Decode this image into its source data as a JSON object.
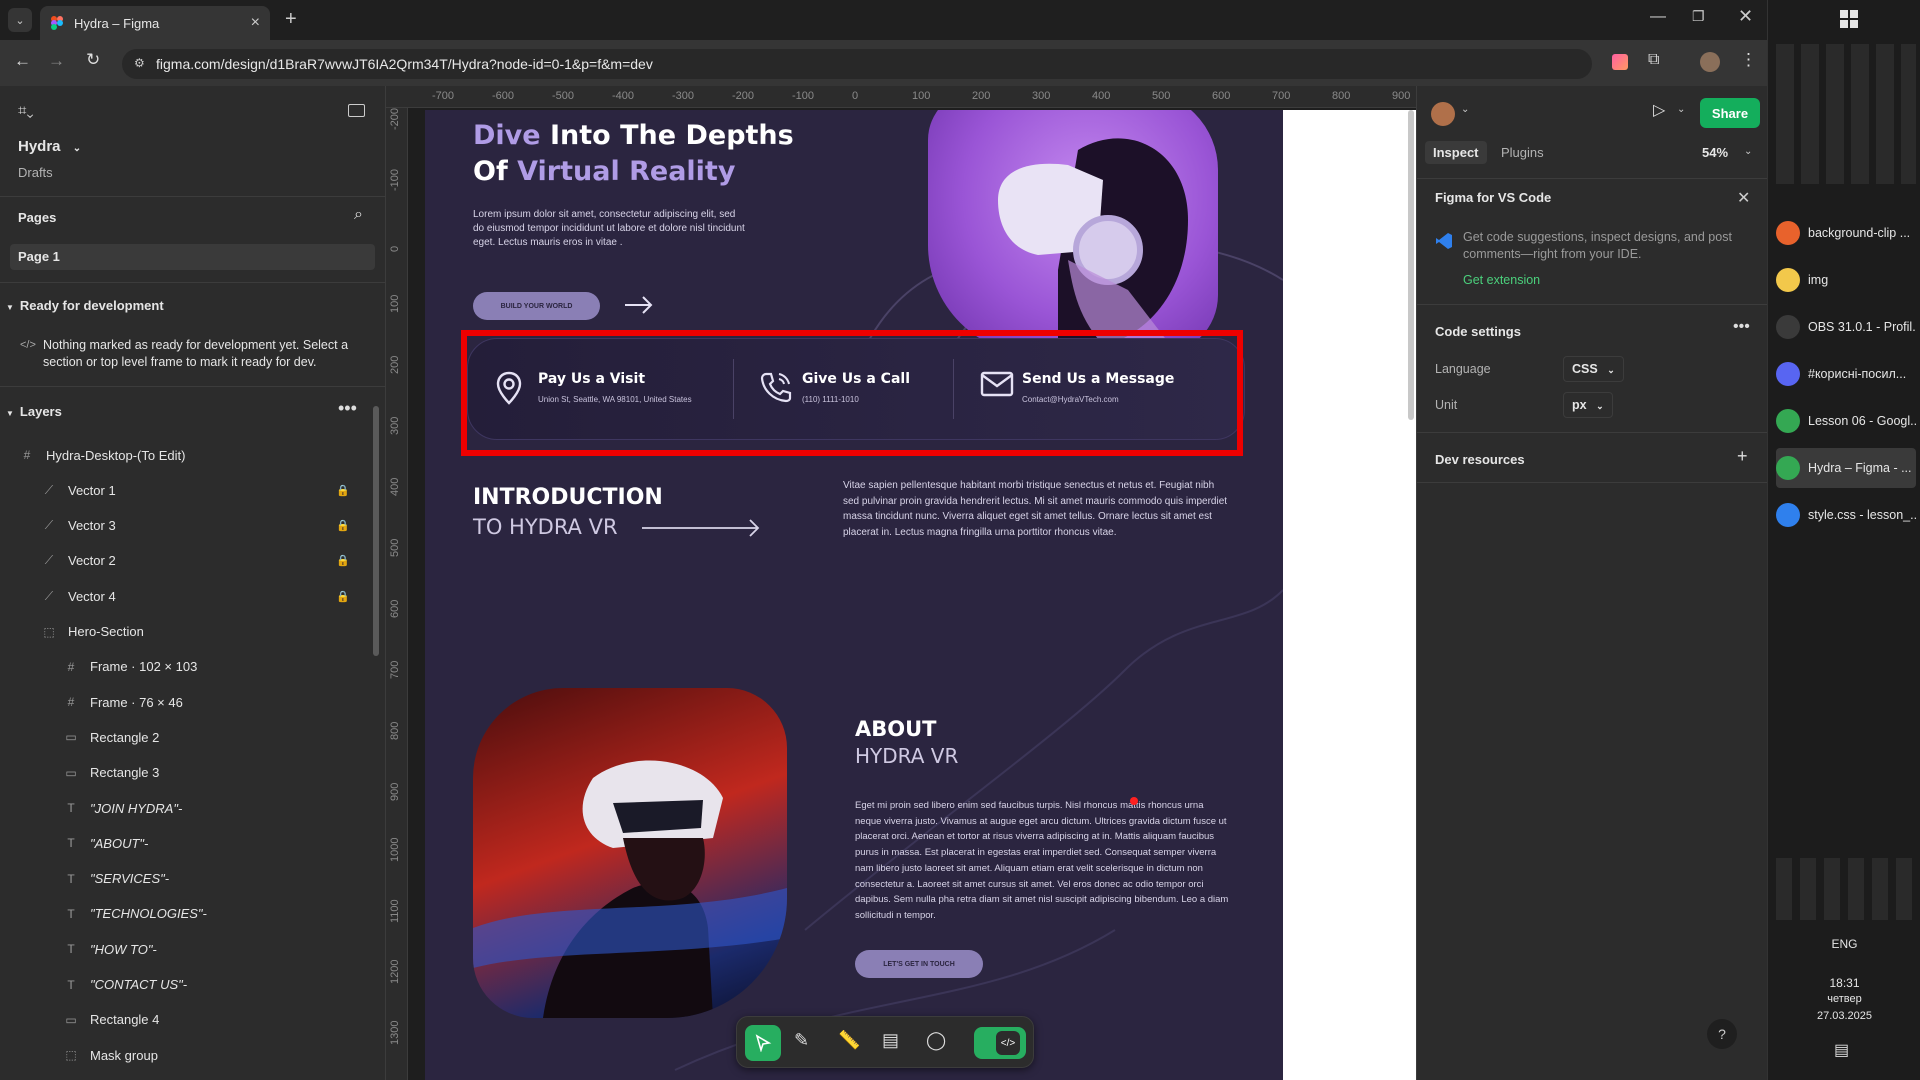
{
  "browser": {
    "tab_title": "Hydra – Figma",
    "url": "figma.com/design/d1BraR7wvwJT6IA2Qrm34T/Hydra?node-id=0-1&p=f&m=dev",
    "new_tab": "+"
  },
  "left_panel": {
    "file_name": "Hydra",
    "file_location": "Drafts",
    "pages_title": "Pages",
    "current_page": "Page 1",
    "ready_title": "Ready for development",
    "ready_message": "Nothing marked as ready for development yet. Select a section or top level frame to mark it ready for dev.",
    "layers_title": "Layers",
    "layers": [
      {
        "name": "Hydra-Desktop-(To Edit)",
        "icon": "frame-icon",
        "indent": 0,
        "locked": false
      },
      {
        "name": "Vector 1",
        "icon": "vector-icon",
        "indent": 1,
        "locked": true
      },
      {
        "name": "Vector 3",
        "icon": "vector-icon",
        "indent": 1,
        "locked": true
      },
      {
        "name": "Vector 2",
        "icon": "vector-icon",
        "indent": 1,
        "locked": true
      },
      {
        "name": "Vector 4",
        "icon": "vector-icon",
        "indent": 1,
        "locked": true
      },
      {
        "name": "Hero-Section",
        "icon": "section-icon",
        "indent": 1,
        "locked": false
      },
      {
        "name": "Frame · 102 × 103",
        "icon": "frame-icon",
        "indent": 2,
        "locked": false
      },
      {
        "name": "Frame · 76 × 46",
        "icon": "frame-icon",
        "indent": 2,
        "locked": false
      },
      {
        "name": "Rectangle 2",
        "icon": "rectangle-icon",
        "indent": 2,
        "locked": false
      },
      {
        "name": "Rectangle 3",
        "icon": "rectangle-icon",
        "indent": 2,
        "locked": false
      },
      {
        "name": "\"JOIN HYDRA\"-",
        "icon": "text-icon",
        "indent": 2,
        "locked": false
      },
      {
        "name": "\"ABOUT\"-",
        "icon": "text-icon",
        "indent": 2,
        "locked": false
      },
      {
        "name": "\"SERVICES\"-",
        "icon": "text-icon",
        "indent": 2,
        "locked": false
      },
      {
        "name": "\"TECHNOLOGIES\"-",
        "icon": "text-icon",
        "indent": 2,
        "locked": false
      },
      {
        "name": "\"HOW TO\"-",
        "icon": "text-icon",
        "indent": 2,
        "locked": false
      },
      {
        "name": "\"CONTACT US\"-",
        "icon": "text-icon",
        "indent": 2,
        "locked": false
      },
      {
        "name": "Rectangle 4",
        "icon": "rectangle-icon",
        "indent": 2,
        "locked": false
      },
      {
        "name": "Mask group",
        "icon": "mask-icon",
        "indent": 2,
        "locked": false
      }
    ]
  },
  "rulers": {
    "top": [
      "-700",
      "-600",
      "-500",
      "-400",
      "-300",
      "-200",
      "-100",
      "0",
      "100",
      "200",
      "300",
      "400",
      "500",
      "600",
      "700",
      "800",
      "900"
    ],
    "left": [
      "-200",
      "-100",
      "0",
      "100",
      "200",
      "300",
      "400",
      "500",
      "600",
      "700",
      "800",
      "900",
      "1000",
      "1100",
      "1200",
      "1300"
    ]
  },
  "design": {
    "hero_title_1a": "Dive",
    "hero_title_1b": " Into The Depths",
    "hero_title_2a": "Of ",
    "hero_title_2b": "Virtual Reality",
    "hero_text": "Lorem ipsum dolor sit amet, consectetur adipiscing elit, sed do eiusmod tempor incididunt ut labore et dolore nisl tincidunt eget. Lectus mauris eros in vitae .",
    "hero_button": "BUILD YOUR WORLD",
    "contact": [
      {
        "title": "Pay Us a Visit",
        "detail": "Union St, Seattle, WA 98101, United States",
        "icon": "map-pin-icon"
      },
      {
        "title": "Give Us a Call",
        "detail": "(110) 1111-1010",
        "icon": "phone-icon"
      },
      {
        "title": "Send Us a Message",
        "detail": "Contact@HydraVTech.com",
        "icon": "mail-icon"
      }
    ],
    "intro_title": "INTRODUCTION",
    "intro_sub": "TO HYDRA VR",
    "intro_text": "Vitae sapien pellentesque habitant morbi tristique senectus et netus et. Feugiat nibh sed pulvinar proin gravida hendrerit lectus. Mi sit amet mauris commodo quis imperdiet massa tincidunt nunc. Viverra aliquet eget sit amet tellus. Ornare lectus sit amet est placerat in. Lectus magna fringilla urna porttitor rhoncus vitae.",
    "about_title": "ABOUT",
    "about_sub": "HYDRA VR",
    "about_text": "Eget mi proin sed libero enim sed faucibus turpis. Nisl rhoncus mattis rhoncus urna neque viverra justo. Vivamus at augue eget arcu dictum. Ultrices gravida dictum fusce ut placerat orci. Aenean et tortor at risus viverra adipiscing at in. Mattis aliquam faucibus purus in massa. Est placerat in egestas erat imperdiet sed. Consequat semper viverra nam libero justo laoreet sit amet. Aliquam etiam erat velit scelerisque in dictum non consectetur a. Laoreet sit amet cursus sit amet. Vel eros donec ac odio tempor orci dapibus. Sem nulla pha retra diam sit amet nisl suscipit adipiscing bibendum. Leo a diam sollicitudi n tempor.",
    "about_button": "LET'S GET IN TOUCH"
  },
  "right_panel": {
    "share": "Share",
    "tab_inspect": "Inspect",
    "tab_plugins": "Plugins",
    "zoom": "54%",
    "vscode_title": "Figma for VS Code",
    "vscode_text": "Get code suggestions, inspect designs, and post comments—right from your IDE.",
    "vscode_link": "Get extension",
    "code_settings": "Code settings",
    "language_label": "Language",
    "language_value": "CSS",
    "unit_label": "Unit",
    "unit_value": "px",
    "dev_resources": "Dev resources",
    "help": "?"
  },
  "taskbar": {
    "windows": [
      {
        "label": "background-clip ...",
        "color": "#e8622c"
      },
      {
        "label": "img",
        "color": "#f2c84b"
      },
      {
        "label": "OBS 31.0.1 - Profil...",
        "color": "#3a3a3a"
      },
      {
        "label": "#корисні-посил...",
        "color": "#5865f2"
      },
      {
        "label": "Lesson 06 - Googl...",
        "color": "#34a853"
      },
      {
        "label": "Hydra – Figma - ...",
        "color": "#34a853"
      },
      {
        "label": "style.css - lesson_...",
        "color": "#2f80ed"
      }
    ],
    "lang": "ENG",
    "time": "18:31",
    "day": "четвер",
    "date": "27.03.2025"
  }
}
